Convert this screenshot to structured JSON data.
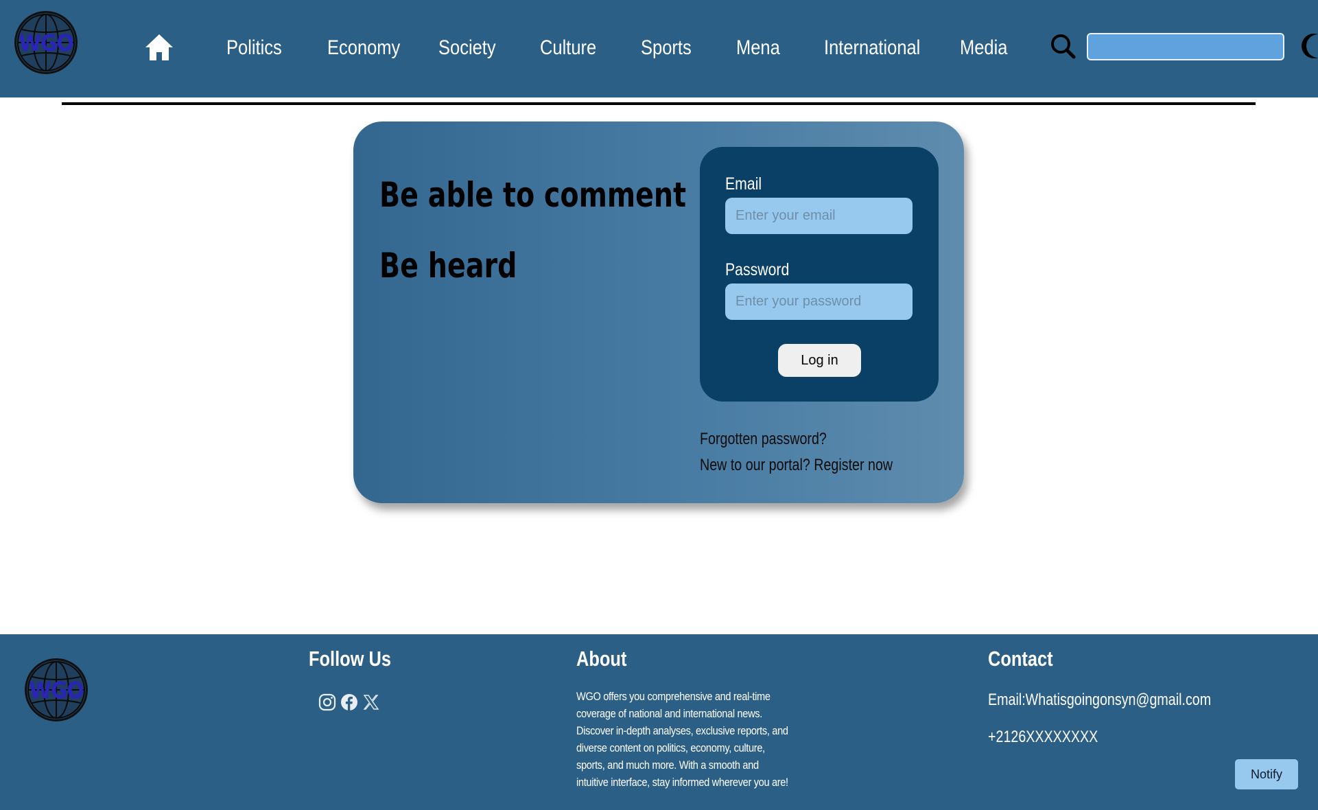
{
  "brand": {
    "logo_text": "WGO"
  },
  "nav": {
    "items": [
      {
        "label": "Politics"
      },
      {
        "label": "Economy"
      },
      {
        "label": "Society"
      },
      {
        "label": "Culture"
      },
      {
        "label": "Sports"
      },
      {
        "label": "Mena"
      },
      {
        "label": "International"
      },
      {
        "label": "Media"
      }
    ],
    "search_value": ""
  },
  "hero": {
    "line1": "Be able to comment",
    "line2": "Be heard"
  },
  "login": {
    "email_label": "Email",
    "email_placeholder": "Enter your email",
    "password_label": "Password",
    "password_placeholder": "Enter your password",
    "button_label": "Log in",
    "forgot_link": "Forgotten password?",
    "register_link": "New to our portal? Register now"
  },
  "footer": {
    "follow_heading": "Follow Us",
    "about_heading": "About",
    "about_text": "WGO offers you comprehensive and real-time coverage of national and international news. Discover in-depth analyses, exclusive reports, and diverse content on politics, economy, culture, sports, and much more. With a smooth and intuitive interface, stay informed wherever you are!",
    "contact_heading": "Contact",
    "email": "Email:Whatisgoingonsyn@gmail.com",
    "phone": "+2126XXXXXXXX",
    "social_icons": [
      "instagram-icon",
      "facebook-icon",
      "x-icon"
    ]
  },
  "notify_label": "Notify",
  "colors": {
    "header_bg": "#2c5f85",
    "login_box_bg": "#0a3f66",
    "input_bg": "#97c9ef",
    "logo_text": "#2a24b8"
  }
}
